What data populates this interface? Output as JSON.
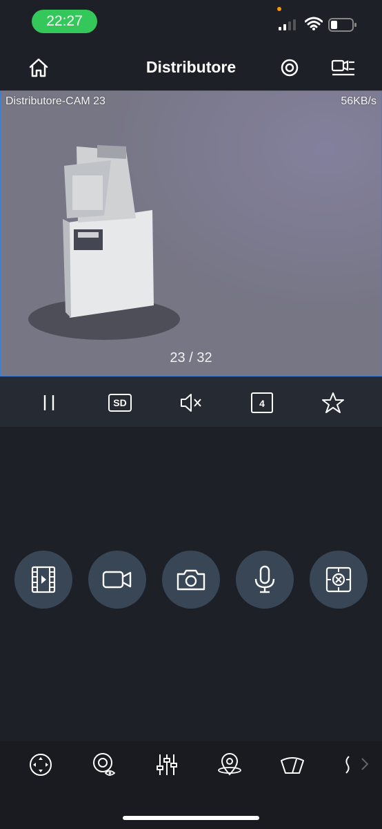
{
  "status_bar": {
    "time": "22:27",
    "time_pill_color": "#34c759",
    "signal_bars": 2
  },
  "header": {
    "title": "Distributore"
  },
  "video": {
    "camera_name": "Distributore-CAM 23",
    "bitrate": "56KB/s",
    "channel_indicator": "23 / 32",
    "border_color": "#3d7dd6"
  },
  "controls": [
    {
      "icon": "pause-icon"
    },
    {
      "icon": "sd-quality-icon",
      "label": "SD"
    },
    {
      "icon": "mute-icon"
    },
    {
      "icon": "split-4-icon",
      "label": "4"
    },
    {
      "icon": "star-icon"
    }
  ],
  "actions": [
    {
      "icon": "playback-film-icon"
    },
    {
      "icon": "record-video-icon"
    },
    {
      "icon": "snapshot-camera-icon"
    },
    {
      "icon": "talk-microphone-icon"
    },
    {
      "icon": "fisheye-icon"
    }
  ],
  "toolbar": [
    {
      "icon": "ptz-icon"
    },
    {
      "icon": "eye-view-icon"
    },
    {
      "icon": "image-adjust-icon"
    },
    {
      "icon": "preset-point-icon"
    },
    {
      "icon": "wiper-icon"
    },
    {
      "icon": "more-partial-icon"
    }
  ],
  "colors": {
    "background": "#1d2026",
    "control_bar": "#262a33",
    "action_button": "#394656"
  }
}
